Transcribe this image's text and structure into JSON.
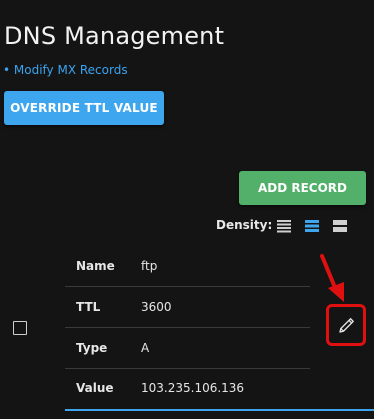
{
  "header": {
    "title": "DNS Management",
    "link_text": "• Modify MX Records"
  },
  "toolbar": {
    "override_label": "OVERRIDE TTL VALUE",
    "add_record_label": "ADD RECORD",
    "density_label": "Density:",
    "density_options": [
      "compact",
      "standard",
      "comfortable"
    ],
    "density_selected": "standard"
  },
  "record": {
    "fields": [
      {
        "label": "Name",
        "value": "ftp"
      },
      {
        "label": "TTL",
        "value": "3600"
      },
      {
        "label": "Type",
        "value": "A"
      },
      {
        "label": "Value",
        "value": "103.235.106.136"
      }
    ]
  },
  "icons": {
    "edit": "pencil-icon",
    "annotation_arrow": "arrow-icon"
  },
  "colors": {
    "background": "#141414",
    "accent_blue": "#3ea6ee",
    "accent_green": "#52b06a",
    "highlight_red": "#e01010",
    "link_blue": "#3aa3f0"
  }
}
